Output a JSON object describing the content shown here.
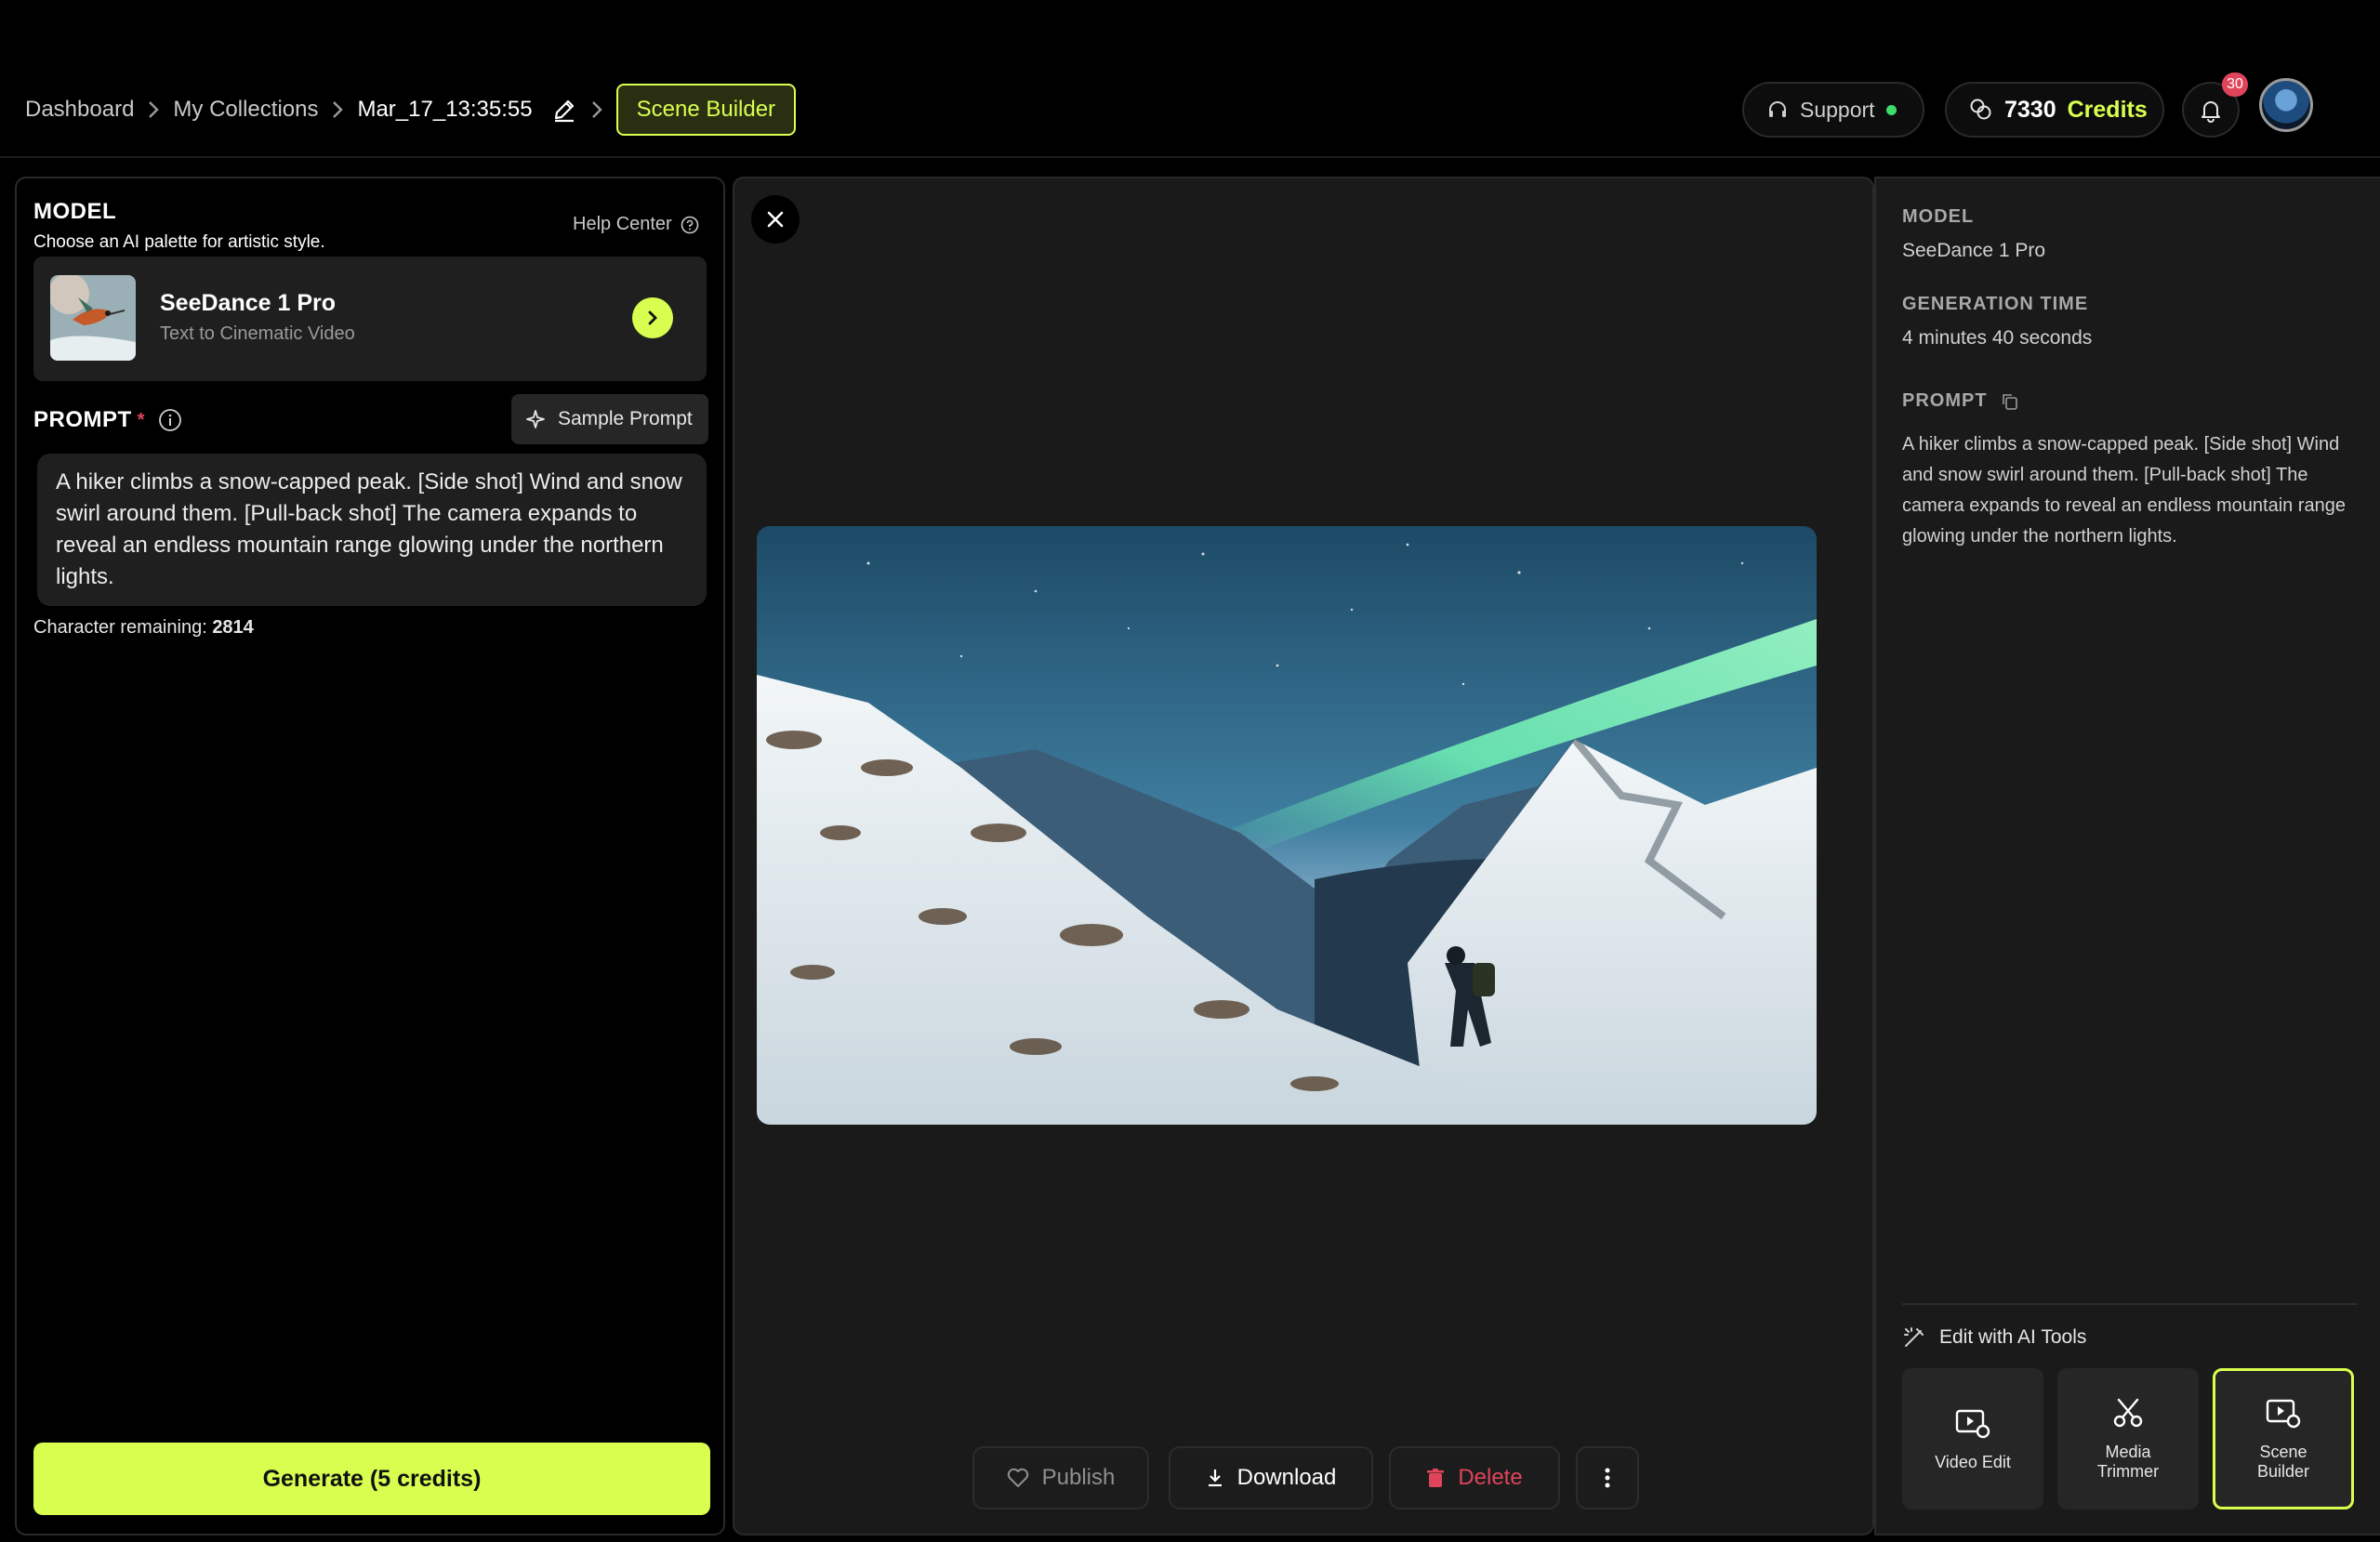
{
  "breadcrumb": {
    "dashboard": "Dashboard",
    "collections": "My Collections",
    "current": "Mar_17_13:35:55",
    "scene_builder": "Scene Builder"
  },
  "header": {
    "support": "Support",
    "credits_count": "7330",
    "credits_label": "Credits",
    "notifications": "30"
  },
  "left": {
    "model_title": "MODEL",
    "model_subtitle": "Choose an AI palette for artistic style.",
    "help_center": "Help Center",
    "model_name": "SeeDance 1 Pro",
    "model_desc": "Text to Cinematic Video",
    "prompt_label": "PROMPT",
    "required": "*",
    "sample_prompt": "Sample Prompt",
    "prompt_text": "A hiker climbs a snow-capped peak. [Side shot] Wind and snow swirl around them. [Pull-back shot] The camera expands to reveal an endless mountain range glowing under the northern lights.",
    "char_label": "Character remaining:",
    "char_count": "2814",
    "generate": "Generate (5 credits)"
  },
  "actions": {
    "publish": "Publish",
    "download": "Download",
    "delete": "Delete"
  },
  "right": {
    "model_label": "MODEL",
    "model_value": "SeeDance 1 Pro",
    "gen_time_label": "GENERATION TIME",
    "gen_time_value": "4 minutes 40 seconds",
    "prompt_label": "PROMPT",
    "prompt_text": "A hiker climbs a snow-capped peak. [Side shot] Wind and snow swirl around them. [Pull-back shot] The camera expands to reveal an endless mountain range glowing under the northern lights.",
    "tools_label": "Edit with AI Tools",
    "tools": [
      "Video Edit",
      "Media Trimmer",
      "Scene Builder"
    ]
  },
  "colors": {
    "accent": "#d8ff4f",
    "danger": "#e0445a",
    "panel": "#1a1a1a",
    "status_online": "#3ddc6b"
  }
}
